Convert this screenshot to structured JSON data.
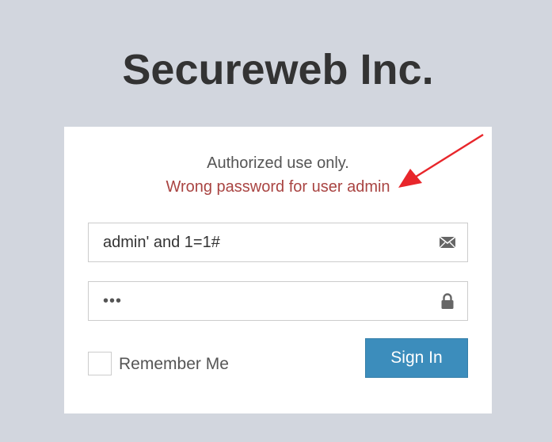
{
  "header": {
    "title": "Secureweb Inc."
  },
  "login": {
    "notice": "Authorized use only.",
    "error": "Wrong password for user admin",
    "username": {
      "value": "admin' and 1=1#",
      "icon": "envelope-icon"
    },
    "password": {
      "value": "•••",
      "icon": "lock-icon"
    },
    "remember_label": "Remember Me",
    "remember_checked": false,
    "signin_label": "Sign In"
  },
  "annotation": {
    "arrow_color": "#e8262b"
  },
  "colors": {
    "background": "#d2d6de",
    "panel": "#ffffff",
    "error": "#a94442",
    "button": "#3c8dbc"
  }
}
